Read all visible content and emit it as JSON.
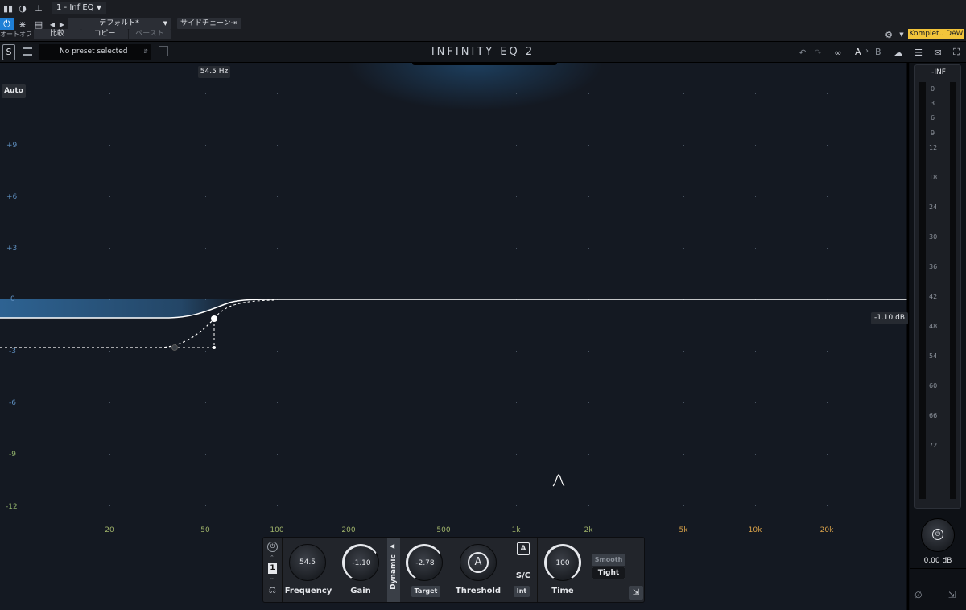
{
  "host": {
    "track_title": "1 - Inf EQ",
    "power_label": "オートオフ",
    "compare_label": "比較",
    "copy_label": "コピー",
    "paste_label": "ペースト",
    "preset_default": "デフォルト*",
    "sidechain_label": "サイドチェーン",
    "komplete_label": "Komplet.. DAW"
  },
  "plugin": {
    "preset_placeholder": "No preset selected",
    "brand": "INFINITY EQ 2",
    "ab_a": "A",
    "ab_b": "B"
  },
  "graph": {
    "auto_label": "Auto",
    "freq_tooltip": "54.5 Hz",
    "gain_tag": "-1.10 dB",
    "db_labels": [
      "+9",
      "+6",
      "+3",
      "0",
      "-3",
      "-6",
      "-9",
      "-12"
    ],
    "freq_labels": [
      "20",
      "50",
      "100",
      "200",
      "500",
      "1k",
      "2k",
      "5k",
      "10k",
      "20k"
    ]
  },
  "band": {
    "number": "1",
    "frequency_value": "54.5",
    "frequency_label": "Frequency",
    "gain_value": "-1.10",
    "gain_label": "Gain",
    "dynamic_label": "Dynamic",
    "target_value": "-2.78",
    "target_label": "Target",
    "threshold_glyph": "A",
    "threshold_label": "Threshold",
    "sc_a": "A",
    "sc_label": "S/C",
    "sc_int": "Int",
    "time_value": "100",
    "time_label": "Time",
    "smooth_label": "Smooth",
    "tight_label": "Tight"
  },
  "meter": {
    "top_label": "-INF",
    "ticks": [
      "0",
      "3",
      "6",
      "9",
      "12",
      "18",
      "24",
      "30",
      "36",
      "42",
      "48",
      "54",
      "60",
      "66",
      "72"
    ],
    "output_value": "0.00 dB"
  },
  "colors": {
    "accent_blue": "#3a86c8",
    "komplete_yellow": "#f2c43a"
  }
}
